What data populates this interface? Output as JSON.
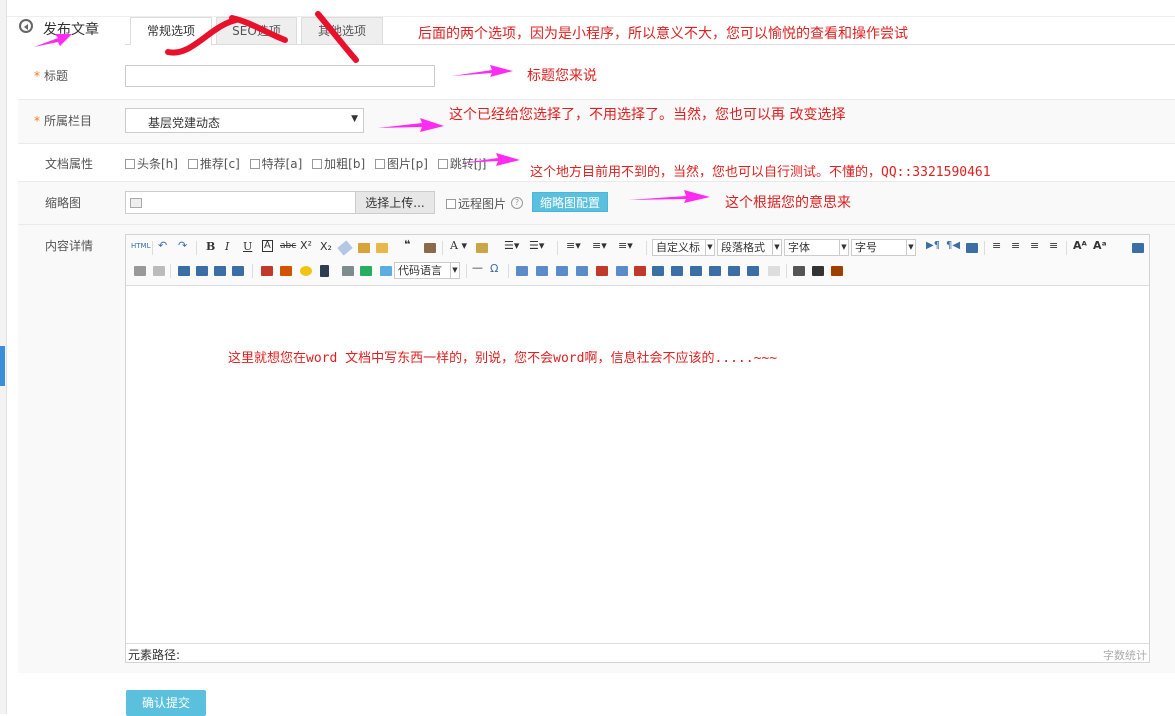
{
  "header": {
    "title": "发布文章"
  },
  "tabs": [
    {
      "label": "常规选项",
      "active": true
    },
    {
      "label": "SEO选项",
      "active": false
    },
    {
      "label": "其他选项",
      "active": false
    }
  ],
  "form": {
    "title_label": "标题",
    "title_value": "",
    "category_label": "所属栏目",
    "category_value": "基层党建动态",
    "attr_label": "文档属性",
    "attrs": [
      "头条[h]",
      "推荐[c]",
      "特荐[a]",
      "加粗[b]",
      "图片[p]",
      "跳转[j]"
    ],
    "thumb_label": "缩略图",
    "upload_btn": "选择上传...",
    "remote_label": "远程图片",
    "thumb_config_btn": "缩略图配置",
    "content_label": "内容详情",
    "submit_btn": "确认提交"
  },
  "editor": {
    "combos": {
      "custom_title": "自定义标",
      "paragraph": "段落格式",
      "font_family": "字体",
      "font_size": "字号",
      "code_lang": "代码语言"
    },
    "status_path": "元素路径:",
    "word_count": "字数统计"
  },
  "annotations": {
    "tabs_note": "后面的两个选项，因为是小程序，所以意义不大，您可以愉悦的查看和操作尝试",
    "title_note": "标题您来说",
    "category_note": "这个已经给您选择了，不用选择了。当然，您也可以再 改变选择",
    "attr_note": "这个地方目前用不到的，当然，您也可以自行测试。不懂的，QQ::3321590461",
    "thumb_note": "这个根据您的意思来",
    "content_note": "这里就想您在word 文档中写东西一样的，别说，您不会word啊，信息社会不应该的.....~~~"
  },
  "colors": {
    "annotation_text": "#e02020",
    "annotation_arrow": "#ff2bf0",
    "accent": "#5bc0de",
    "required": "#f37b1d"
  }
}
